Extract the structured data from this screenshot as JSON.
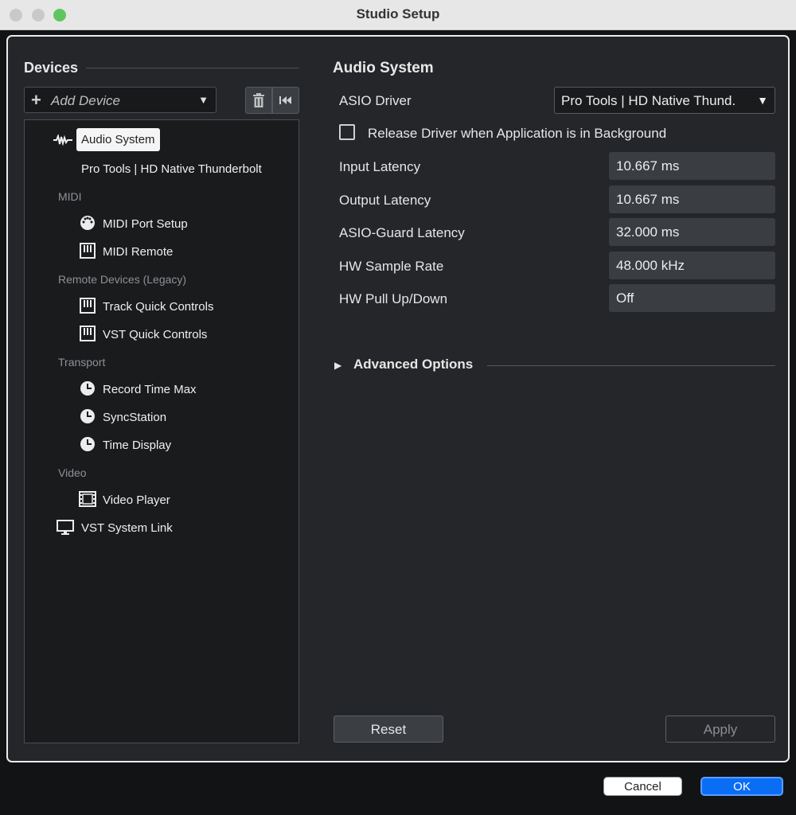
{
  "window": {
    "title": "Studio Setup"
  },
  "devices": {
    "title": "Devices",
    "add_device_plus": "+",
    "add_device_label": "Add Device",
    "add_device_caret": "▼",
    "trash_icon": "🗑",
    "reset_icon": "⏮",
    "tree": {
      "audio_system": "Audio System",
      "pro_tools": "Pro Tools | HD Native Thunderbolt",
      "cat_midi": "MIDI",
      "midi_port_setup": "MIDI Port Setup",
      "midi_remote": "MIDI Remote",
      "cat_remote": "Remote Devices (Legacy)",
      "track_quick_controls": "Track Quick Controls",
      "vst_quick_controls": "VST Quick Controls",
      "cat_transport": "Transport",
      "record_time_max": "Record Time Max",
      "syncstation": "SyncStation",
      "time_display": "Time Display",
      "cat_video": "Video",
      "video_player": "Video Player",
      "vst_system_link": "VST System Link"
    },
    "icons": {
      "waveform": "waveform-icon",
      "midi_port": "midi-port-icon",
      "keyboard": "keyboard-icon",
      "clock": "clock-icon",
      "film": "film-icon",
      "monitor": "monitor-icon"
    }
  },
  "audio_system": {
    "title": "Audio System",
    "asio_driver_label": "ASIO Driver",
    "asio_driver_value": "Pro Tools | HD Native Thund.",
    "release_label": "Release Driver when Application is in Background",
    "rows": [
      {
        "label": "Input Latency",
        "value": "10.667 ms"
      },
      {
        "label": "Output Latency",
        "value": "10.667 ms"
      },
      {
        "label": "ASIO-Guard Latency",
        "value": "32.000 ms"
      },
      {
        "label": "HW Sample Rate",
        "value": "48.000 kHz"
      },
      {
        "label": "HW Pull Up/Down",
        "value": "Off"
      }
    ],
    "advanced_options": "Advanced Options",
    "reset_label": "Reset",
    "apply_label": "Apply"
  },
  "footer": {
    "cancel_label": "Cancel",
    "ok_label": "OK"
  },
  "colors": {
    "accent": "#0a6ef5",
    "panel": "#242629",
    "tree_bg": "#1a1b1d"
  }
}
